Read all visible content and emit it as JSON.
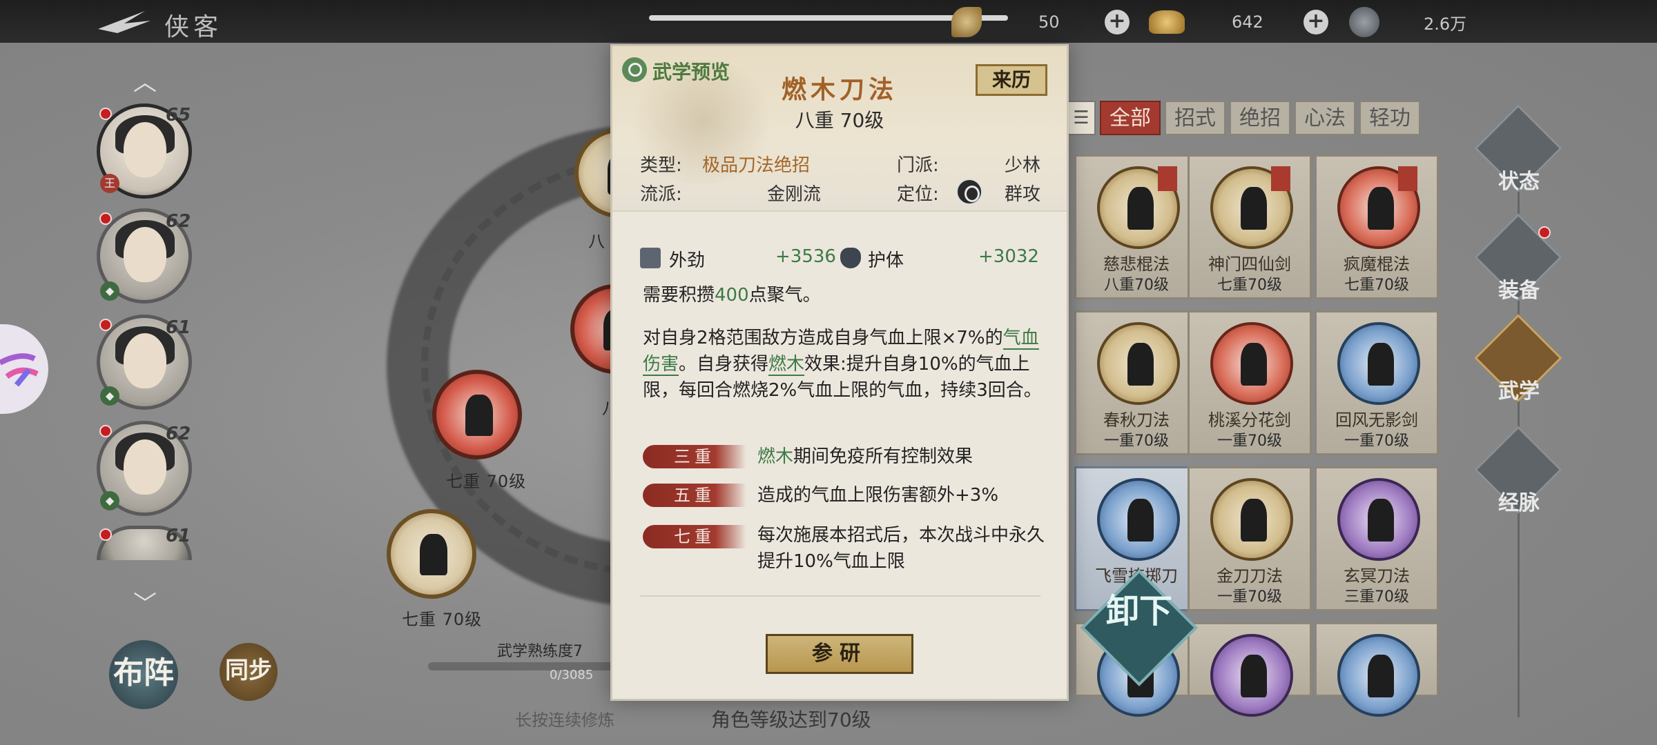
{
  "topbar": {
    "title": "侠客",
    "currencies": [
      {
        "icon": "leaf-coin-icon",
        "value": "50"
      },
      {
        "icon": "gold-ingot-icon",
        "value": "642"
      },
      {
        "icon": "copper-coin-icon",
        "value": "2.6万"
      }
    ]
  },
  "roster": [
    {
      "level": "65",
      "tag": "王",
      "selected": true
    },
    {
      "level": "62",
      "tag": "",
      "selected": false
    },
    {
      "level": "61",
      "tag": "",
      "selected": false
    },
    {
      "level": "62",
      "tag": "",
      "selected": false
    },
    {
      "level": "61",
      "tag": "",
      "selected": false
    }
  ],
  "bottom_buttons": {
    "formation": "布阵",
    "sync": "同步"
  },
  "wheel": {
    "node_labels": [
      "八",
      "八",
      "七重 70级",
      "七重 70级"
    ],
    "proficiency_title": "武学熟练度7",
    "proficiency_value": "0/3085",
    "proficiency_fraction": 0.0,
    "hint_long_press": "长按连续修炼",
    "hint_requirement": "角色等级达到70级"
  },
  "tabs": [
    "☰",
    "全部",
    "招式",
    "绝招",
    "心法",
    "轻功"
  ],
  "grid": [
    {
      "name": "慈悲棍法",
      "level": "八重70级",
      "equipped": true,
      "color": "tan"
    },
    {
      "name": "神门四仙剑",
      "level": "七重70级",
      "equipped": true,
      "color": "tan"
    },
    {
      "name": "疯魔棍法",
      "level": "七重70级",
      "equipped": true,
      "color": "red"
    },
    {
      "name": "春秋刀法",
      "level": "一重70级",
      "equipped": false,
      "color": "tan"
    },
    {
      "name": "桃溪分花剑",
      "level": "一重70级",
      "equipped": false,
      "color": "red"
    },
    {
      "name": "回风无影剑",
      "level": "一重70级",
      "equipped": false,
      "color": "blue"
    },
    {
      "name": "飞雪掩掷刀",
      "level": "",
      "equipped": false,
      "color": "blue"
    },
    {
      "name": "金刀刀法",
      "level": "一重70级",
      "equipped": false,
      "color": "tan"
    },
    {
      "name": "玄冥刀法",
      "level": "三重70级",
      "equipped": false,
      "color": "purple"
    },
    {
      "name": "",
      "level": "",
      "equipped": false,
      "color": "blue"
    },
    {
      "name": "",
      "level": "",
      "equipped": false,
      "color": "purple"
    },
    {
      "name": "",
      "level": "",
      "equipped": false,
      "color": "blue"
    }
  ],
  "unload_label": "卸下",
  "right_nav": [
    {
      "label": "状态",
      "active": false
    },
    {
      "label": "装备",
      "active": false
    },
    {
      "label": "武学",
      "active": true
    },
    {
      "label": "经脉",
      "active": false
    }
  ],
  "popup": {
    "preview_label": "武学预览",
    "title": "燃木刀法",
    "level": "八重 70级",
    "origin_button": "来历",
    "type_key": "类型:",
    "type_value": "极品刀法绝招",
    "sect_key": "门派:",
    "sect_value": "少林",
    "school_key": "流派:",
    "school_value": "金刚流",
    "role_key": "定位:",
    "role_value": "群攻",
    "stats": [
      {
        "name": "外劲",
        "value": "+3536"
      },
      {
        "name": "护体",
        "value": "+3032"
      }
    ],
    "energy_pre": "需要积攒",
    "energy_num": "400",
    "energy_post": "点聚气。",
    "effect": {
      "p1": "对自身2格范围敌方造成自身气血上限×7%的",
      "link1": "气血伤害",
      "p2": "。自身获得",
      "link2": "燃木",
      "p3": "效果:提升自身10%的气血上限，每回合燃烧2%气血上限的气血，持续3回合。"
    },
    "tiers": [
      {
        "label": "三重",
        "hl": "燃木",
        "text": "期间免疫所有控制效果"
      },
      {
        "label": "五重",
        "hl": "",
        "text": "造成的气血上限伤害额外+3%"
      },
      {
        "label": "七重",
        "hl": "",
        "text": "每次施展本招式后，本次战斗中永久提升10%气血上限"
      }
    ],
    "study_button": "参研"
  },
  "colors": {
    "accent_green": "#3b7a45",
    "title_orange": "#a26128",
    "tab_active": "#a33a30"
  }
}
